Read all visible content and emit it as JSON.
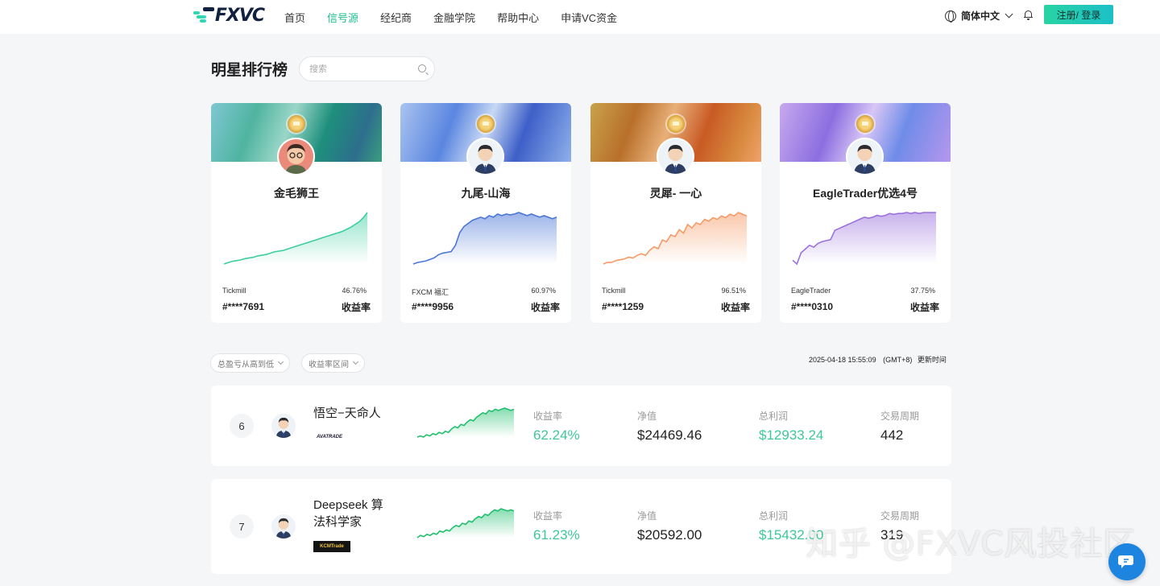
{
  "header": {
    "logo_text": "FXVC",
    "nav": [
      {
        "label": "首页",
        "active": false
      },
      {
        "label": "信号源",
        "active": true
      },
      {
        "label": "经纪商",
        "active": false
      },
      {
        "label": "金融学院",
        "active": false
      },
      {
        "label": "帮助中心",
        "active": false
      },
      {
        "label": "申请VC资金",
        "active": false
      }
    ],
    "language": "简体中文",
    "login_label": "注册/ 登录",
    "icons": {
      "language": "globe-icon",
      "notifications": "bell-icon"
    }
  },
  "page": {
    "title": "明星排行榜",
    "search_placeholder": "搜索"
  },
  "star_cards": [
    {
      "name": "金毛狮王",
      "broker": "Tickmill",
      "percent": "46.76%",
      "account": "#****7691",
      "yield_label": "收益率",
      "theme": "teal-green",
      "line_color": "#3dcea0",
      "series": [
        2,
        3,
        4,
        4.5,
        5,
        6,
        6.5,
        7,
        8,
        8.5,
        9,
        10,
        11,
        11.5,
        12,
        13,
        14,
        15,
        16,
        17,
        18,
        19,
        20,
        21,
        22,
        23,
        24,
        25,
        26,
        27.5,
        29,
        31,
        33,
        36,
        40
      ]
    },
    {
      "name": "九尾-山海",
      "broker": "FXCM 福汇",
      "percent": "60.97%",
      "account": "#****9956",
      "yield_label": "收益率",
      "theme": "blue",
      "line_color": "#4a76d6",
      "series": [
        2,
        3,
        3.5,
        4,
        5,
        6,
        8,
        9,
        9.5,
        10,
        14,
        22,
        26,
        28,
        30,
        31,
        32,
        31,
        33,
        32,
        34,
        33,
        34,
        33.5,
        34,
        35,
        34,
        33,
        34,
        33,
        32,
        33,
        32,
        31,
        32
      ]
    },
    {
      "name": "灵犀- 一心",
      "broker": "Tickmill",
      "percent": "96.51%",
      "account": "#****1259",
      "yield_label": "收益率",
      "theme": "orange",
      "line_color": "#f59a66",
      "series": [
        4,
        5,
        5,
        6,
        6.5,
        7,
        8,
        7.5,
        9,
        10,
        9,
        12,
        14,
        13,
        18,
        17,
        21,
        20,
        24,
        22,
        27,
        25,
        28,
        27,
        30,
        29,
        31,
        30,
        32,
        31,
        33,
        32,
        34,
        33,
        32
      ]
    },
    {
      "name": "EagleTrader优选4号",
      "broker": "EagleTrader",
      "percent": "37.75%",
      "account": "#****0310",
      "yield_label": "收益率",
      "theme": "purple",
      "line_color": "#9b72dc",
      "series": [
        4,
        2,
        8,
        10,
        12,
        11,
        13,
        14,
        14.5,
        15,
        20,
        21,
        22,
        23,
        24,
        25,
        26,
        27,
        26.5,
        27,
        28,
        27.5,
        28,
        29,
        28.5,
        29,
        29,
        29.5,
        29,
        29.5,
        29,
        29.5,
        29.5,
        29.5,
        29.5
      ]
    }
  ],
  "filters": {
    "sort": "总盈亏从高到低",
    "range": "收益率区间"
  },
  "update": {
    "time": "2025-04-18 15:55:09",
    "tz": "(GMT+8)",
    "label": "更新时间"
  },
  "stat_labels": {
    "yield": "收益率",
    "net_value": "净值",
    "total_profit": "总利润",
    "period": "交易周期"
  },
  "rows": [
    {
      "rank": "6",
      "name": "悟空−天命人",
      "broker_logo": "AVATRADE",
      "yield": "62.24%",
      "net_value": "$24469.46",
      "total_profit": "$12933.24",
      "period": "442",
      "series": [
        3,
        4,
        3,
        5,
        4,
        6,
        5,
        7,
        6,
        8,
        7,
        10,
        12,
        11,
        14,
        13,
        16,
        18,
        17,
        20,
        22,
        24,
        23,
        26,
        25,
        27,
        26,
        27,
        28,
        27,
        26,
        27
      ]
    },
    {
      "rank": "7",
      "name": "Deepseek 算法科学家",
      "broker_logo": "KCMTrade",
      "yield": "61.23%",
      "net_value": "$20592.00",
      "total_profit": "$15432.00",
      "period": "319",
      "series": [
        3,
        5,
        4,
        6,
        5,
        7,
        6,
        9,
        8,
        10,
        9,
        12,
        14,
        13,
        16,
        15,
        18,
        17,
        20,
        22,
        21,
        24,
        23,
        26,
        28,
        27,
        29,
        28,
        27,
        28,
        27
      ]
    }
  ],
  "watermark": "知乎 @FXVC风投社区",
  "colors": {
    "accent": "#1cbf8e",
    "positive": "#3ec79a"
  },
  "chat_icon": "chat-bubble-icon"
}
